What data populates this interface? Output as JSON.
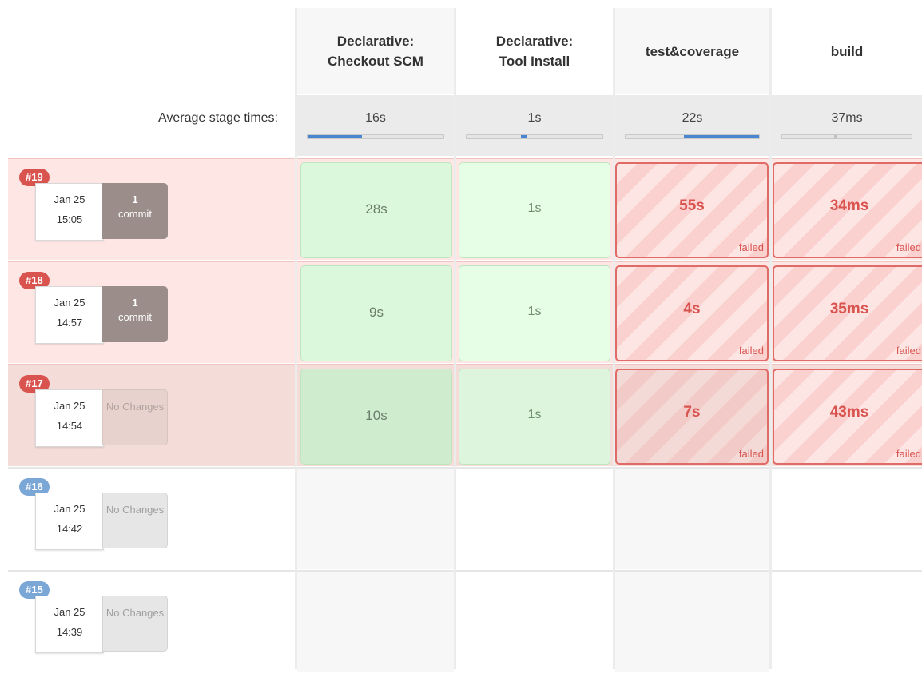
{
  "stages": [
    {
      "name_line1": "Declarative:",
      "name_line2": "Checkout SCM",
      "avg": "16s"
    },
    {
      "name_line1": "Declarative:",
      "name_line2": "Tool Install",
      "avg": "1s"
    },
    {
      "name_line1": "test&coverage",
      "name_line2": "",
      "avg": "22s"
    },
    {
      "name_line1": "build",
      "name_line2": "",
      "avg": "37ms"
    }
  ],
  "avg_label": "Average stage times:",
  "avg_bar_fractions": [
    0.4,
    0.04,
    0.55,
    0.02
  ],
  "builds": [
    {
      "number": "#19",
      "date": "Jan 25",
      "time": "15:05",
      "commits_count": "1",
      "commits_label": "commit",
      "status": "failed",
      "stage_times": [
        "28s",
        "1s",
        "55s",
        "34ms"
      ],
      "stage_status": [
        "success",
        "success",
        "failed",
        "failed"
      ]
    },
    {
      "number": "#18",
      "date": "Jan 25",
      "time": "14:57",
      "commits_count": "1",
      "commits_label": "commit",
      "status": "failed",
      "stage_times": [
        "9s",
        "1s",
        "4s",
        "35ms"
      ],
      "stage_status": [
        "success",
        "success",
        "failed",
        "failed"
      ]
    },
    {
      "number": "#17",
      "date": "Jan 25",
      "time": "14:54",
      "commits_count": "",
      "commits_label": "No Changes",
      "status": "failed",
      "stage_times": [
        "10s",
        "1s",
        "7s",
        "43ms"
      ],
      "stage_status": [
        "success",
        "success",
        "failed",
        "failed"
      ]
    },
    {
      "number": "#16",
      "date": "Jan 25",
      "time": "14:42",
      "commits_count": "",
      "commits_label": "No Changes",
      "status": "none",
      "stage_times": [],
      "stage_status": []
    },
    {
      "number": "#15",
      "date": "Jan 25",
      "time": "14:39",
      "commits_count": "",
      "commits_label": "No Changes",
      "status": "none",
      "stage_times": [],
      "stage_status": []
    }
  ],
  "failed_label": "failed",
  "colors": {
    "failed_accent": "#d9534f",
    "success_bg": "#dcf8dc",
    "running_blue": "#4a86d0"
  }
}
